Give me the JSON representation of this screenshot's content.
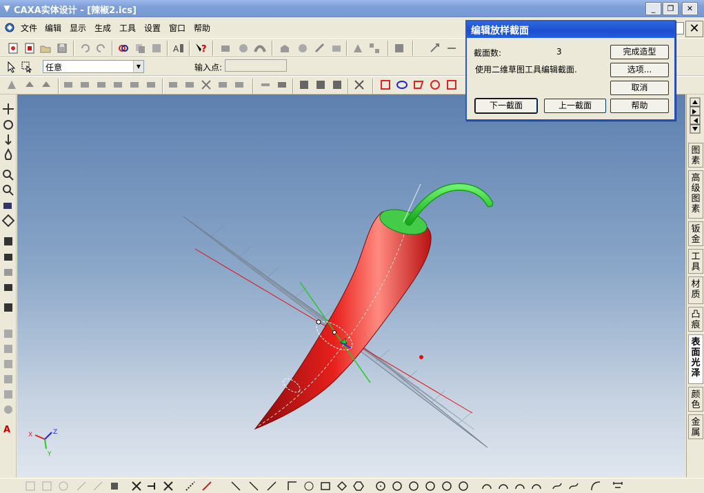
{
  "window": {
    "title": "CAXA实体设计 - [辣椒2.ics]",
    "minimize": "_",
    "restore": "❐",
    "close": "✕"
  },
  "menu": {
    "items": [
      "文件",
      "编辑",
      "显示",
      "生成",
      "工具",
      "设置",
      "窗口",
      "帮助"
    ]
  },
  "toolbar2": {
    "select_value": "任意",
    "input_label": "输入点:",
    "input_value": ""
  },
  "dialog": {
    "title": "编辑放样截面",
    "count_label": "截面数:",
    "count_value": "3",
    "hint": "使用二维草图工具编辑截面.",
    "finish_label": "完成造型",
    "options_label": "选项...",
    "cancel_label": "取消",
    "help_label": "帮助",
    "next_label": "下一截面",
    "prev_label": "上一截面"
  },
  "righttabs": [
    "图素",
    "高级图素",
    "钣金",
    "工具",
    "材质",
    "凸痕",
    "表面光泽",
    "颜色",
    "金属"
  ],
  "edge_close": "✕",
  "colors": {
    "title_bar": "#7f9fd8",
    "dialog_title": "#1c4ed0",
    "pepper_red": "#d81818",
    "stem_green": "#22c828",
    "viewport_top": "#5d80b0",
    "viewport_bottom": "#e0e6ee"
  },
  "axes": {
    "x": "X",
    "y": "Y",
    "z": "Z"
  }
}
